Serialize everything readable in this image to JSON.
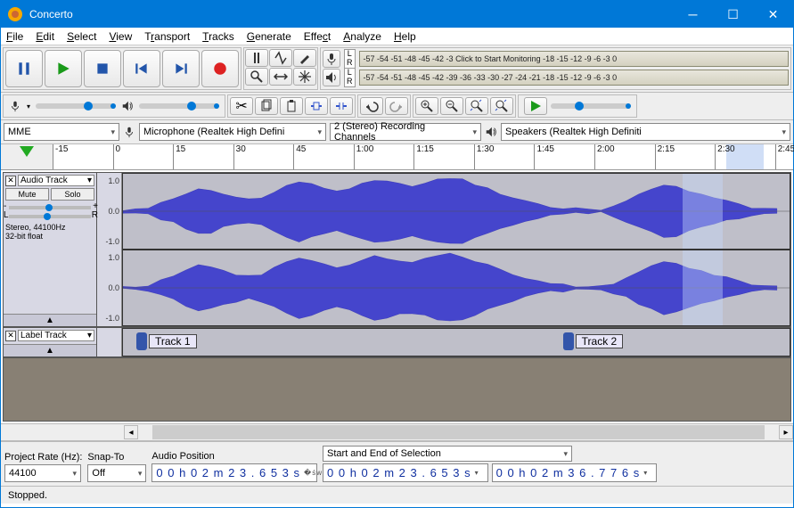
{
  "window": {
    "title": "Concerto"
  },
  "menu": {
    "items": [
      "File",
      "Edit",
      "Select",
      "View",
      "Transport",
      "Tracks",
      "Generate",
      "Effect",
      "Analyze",
      "Help"
    ]
  },
  "meters": {
    "rec_scale": "-57 -54 -51 -48 -45 -42 -3",
    "rec_text": "Click to Start Monitoring",
    "rec_tail": "-18 -15 -12  -9  -6  -3  0",
    "play_scale": "-57 -54 -51 -48 -45 -42 -39 -36 -33 -30 -27 -24 -21 -18 -15 -12  -9  -6  -3  0"
  },
  "devices": {
    "host": "MME",
    "input": "Microphone (Realtek High Defini",
    "channels": "2 (Stereo) Recording Channels",
    "output": "Speakers (Realtek High Definiti"
  },
  "timeline": {
    "ticks": [
      "-15",
      "0",
      "15",
      "30",
      "45",
      "1:00",
      "1:15",
      "1:30",
      "1:45",
      "2:00",
      "2:15",
      "2:30",
      "2:45"
    ]
  },
  "audio_track": {
    "name": "Audio Track",
    "mute": "Mute",
    "solo": "Solo",
    "meta1": "Stereo, 44100Hz",
    "meta2": "32-bit float",
    "scale": [
      "1.0",
      "0.0",
      "-1.0"
    ]
  },
  "label_track": {
    "name": "Label Track",
    "labels": [
      {
        "text": "Track 1",
        "pos_pct": 2
      },
      {
        "text": "Track 2",
        "pos_pct": 66
      }
    ]
  },
  "bottom": {
    "rate_label": "Project Rate (Hz):",
    "rate_value": "44100",
    "snap_label": "Snap-To",
    "snap_value": "Off",
    "audio_pos_label": "Audio Position",
    "audio_pos_value": "0 0 h 0 2 m 2 3 . 6 5 3 s",
    "sel_label": "Start and End of Selection",
    "sel_start": "0 0 h 0 2 m 2 3 . 6 5 3 s",
    "sel_end": "0 0 h 0 2 m 3 6 . 7 7 6 s"
  },
  "status": "Stopped."
}
